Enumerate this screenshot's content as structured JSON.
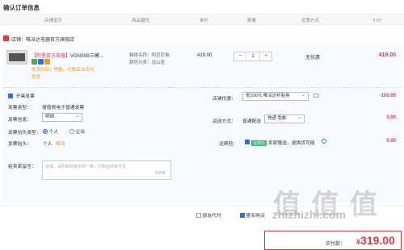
{
  "page_title": "确认订单信息",
  "columns": [
    "店铺宝贝",
    "商品属性",
    "单价",
    "数量",
    "优惠方式",
    "小计"
  ],
  "store": {
    "label": "店铺：",
    "name": "唯派达电器官方旗舰店"
  },
  "item": {
    "tag": "【阿里官方自营】",
    "title": "VGNS99三模...",
    "delivery_line1": "发货时间：预售，付款后15天内",
    "delivery_line2": "发货",
    "color_label": "轴体名称：阿尼巨轴",
    "color2_label": "颜色分类：远山蓝",
    "unit_price": "419.00",
    "qty": "1",
    "qty_minus": "−",
    "qty_plus": "+",
    "promo": "无优惠",
    "subtotal": "419.00"
  },
  "invoice": {
    "toggle_label": "开具发票",
    "type_label": "发票类型：",
    "type_value": "增值税电子普通发票",
    "content_label": "发票信息：",
    "content_value": "明细",
    "title_type_label": "发票抬头类型：",
    "opt_personal": "个人",
    "opt_company": "企业",
    "title_label": "发票抬头：",
    "title_value": "个人",
    "modify_link": "修改"
  },
  "remark": {
    "label": "给卖家留言：",
    "placeholder": "选填，请先和商家协商一致，付款后商家可见",
    "counter": "0/200"
  },
  "store_discount": {
    "label": "店铺优惠：",
    "value": "省100元:唯派达补贴券",
    "amount": "-100.00"
  },
  "shipping": {
    "label": "运送方式：",
    "type": "普通配送",
    "select": "快递 免邮",
    "amount": "0.00"
  },
  "insurance": {
    "label": "运费险：",
    "badge": "运费险",
    "text": "卖家赠送，退换货可赔",
    "amount": "0.00"
  },
  "options": {
    "anonymous": "匿名购买",
    "friend_pay": "朋友代付"
  },
  "pay": {
    "label": "实付款：",
    "currency": "¥",
    "amount": "319.00"
  },
  "watermark": {
    "main": "值|值|值",
    "sub": "zhizhizhi.com"
  },
  "colors": {
    "accent": "#e4393c",
    "link": "#2c6ef2",
    "orange": "#f39800"
  }
}
